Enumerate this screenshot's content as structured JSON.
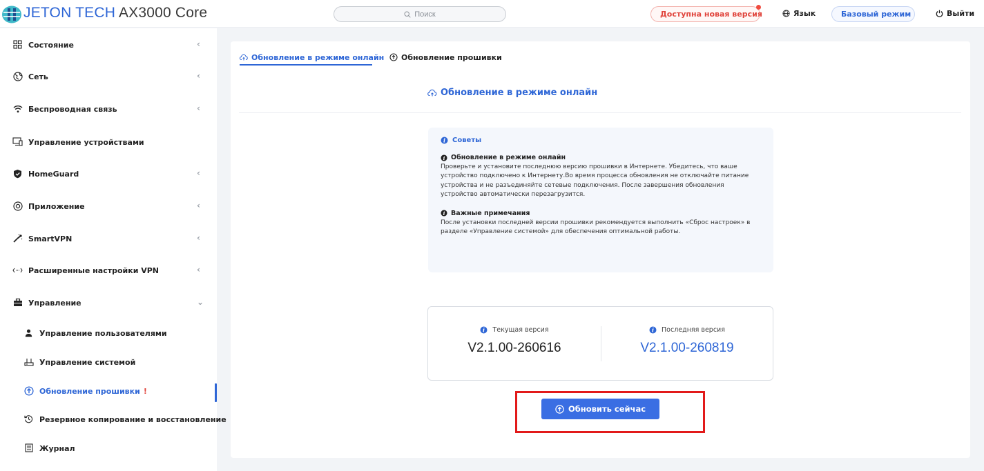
{
  "header": {
    "brand": "JETON TECH",
    "model": "AX3000 Core",
    "search_placeholder": "Поиск",
    "update_available": "Доступна новая версия",
    "language": "Язык",
    "basic_mode": "Базовый режим",
    "logout": "Выйти"
  },
  "sidebar": {
    "items": [
      {
        "label": "Состояние",
        "icon": "dashboard-icon"
      },
      {
        "label": "Сеть",
        "icon": "globe-icon"
      },
      {
        "label": "Беспроводная связь",
        "icon": "wifi-icon"
      },
      {
        "label": "Управление устройствами",
        "icon": "devices-icon"
      },
      {
        "label": "HomeGuard",
        "icon": "shield-icon"
      },
      {
        "label": "Приложение",
        "icon": "app-icon"
      },
      {
        "label": "SmartVPN",
        "icon": "vpn-icon"
      },
      {
        "label": "Расширенные настройки VPN",
        "icon": "arrows-icon"
      },
      {
        "label": "Управление",
        "icon": "toolbox-icon"
      }
    ],
    "sub_items": [
      {
        "label": "Управление пользователями",
        "icon": "user-icon"
      },
      {
        "label": "Управление системой",
        "icon": "system-icon"
      },
      {
        "label": "Обновление прошивки",
        "icon": "upload-icon",
        "badge": "!"
      },
      {
        "label": "Резервное копирование и восстановление",
        "icon": "restore-icon"
      },
      {
        "label": "Журнал",
        "icon": "log-icon"
      }
    ]
  },
  "tabs": {
    "online": "Обновление в режиме онлайн",
    "firmware": "Обновление прошивки"
  },
  "section_title": "Обновление в режиме онлайн",
  "tips": {
    "heading": "Советы",
    "online_title": "Обновление в режиме онлайн",
    "online_text": "Проверьте и установите последнюю версию прошивки в Интернете. Убедитесь, что ваше устройство подключено к Интернету.Во время процесса обновления не отключайте питание устройства и не разъединяйте сетевые подключения. После завершения обновления устройство автоматически перезагрузится.",
    "notes_title": "Важные примечания",
    "notes_text": "После установки последней версии прошивки рекомендуется выполнить «Сброс настроек» в разделе «Управление системой» для обеспечения оптимальной работы."
  },
  "versions": {
    "current_label": "Текущая версия",
    "current_value": "V2.1.00-260616",
    "latest_label": "Последняя версия",
    "latest_value": "V2.1.00-260819"
  },
  "update_button": "Обновить сейчас",
  "colors": {
    "accent": "#2e66d6",
    "button": "#3a6ee3",
    "alert": "#e0443c",
    "highlight": "#e21a1a"
  }
}
